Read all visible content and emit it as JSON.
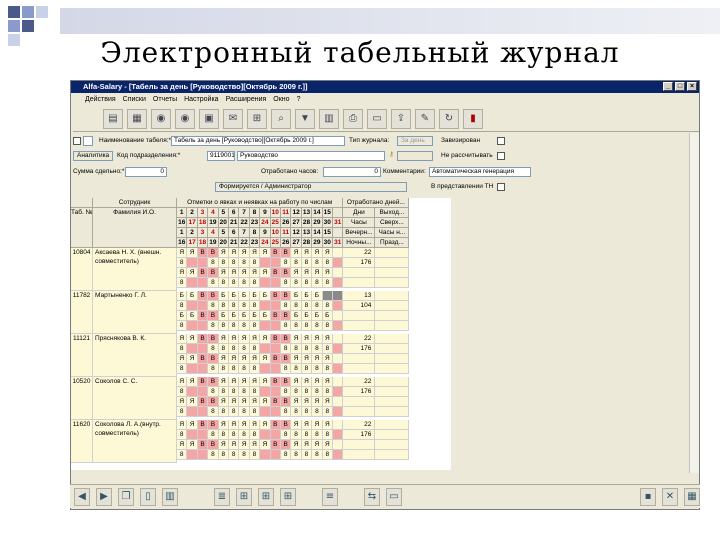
{
  "slide_title": "Электронный табельный журнал",
  "window": {
    "title": "Alfa-Salary - [Табель за день [Руководство][Октябрь 2009 г.]]",
    "controls": [
      "_",
      "□",
      "×"
    ]
  },
  "menu": [
    "Действия",
    "Списки",
    "Отчеты",
    "Настройка",
    "Расширения",
    "Окно",
    "?"
  ],
  "form": {
    "name_label": "Наименование табеля:*",
    "name_value": "Табель за день [Руководство][Октябрь 2009 г.]",
    "journal_type_label": "Тип журнала:",
    "journal_type_value": "За день",
    "completed_label": "Завизирован",
    "analytics_button": "Аналитика",
    "dept_code_label": "Код подразделения:*",
    "dept_code_value": "9119001",
    "dept_name_value": "Руководство",
    "no_calc_label": "Не рассчитывать",
    "sum_label": "Сумма сдельно:*",
    "sum_value": "0",
    "worked_hours_label": "Отработано часов:",
    "worked_hours_value": "0",
    "comment_label": "Комментарии:",
    "comment_value": "Автоматическая генерация",
    "formed_value": "Формируется / Администратор",
    "in_tn_label": "В представлении ТН"
  },
  "grid": {
    "col_tab": "Таб. №",
    "col_emp_header": "Сотрудник",
    "col_fio": "Фамилия И.О.",
    "marks_header": "Отметки о явках и неявках на работу по числам",
    "worked_header": "Отработано дней...",
    "day_row1": [
      "1",
      "2",
      "3",
      "4",
      "5",
      "6",
      "7",
      "8",
      "9",
      "10",
      "11",
      "12",
      "13",
      "14",
      "15"
    ],
    "day_row2": [
      "16",
      "17",
      "18",
      "19",
      "20",
      "21",
      "22",
      "23",
      "24",
      "25",
      "26",
      "27",
      "28",
      "29",
      "30",
      "31"
    ],
    "worked_sub": [
      [
        "Дни",
        "Выход..."
      ],
      [
        "Часы",
        "Сверх..."
      ],
      [
        "Вечерн...",
        "Часы н..."
      ],
      [
        "Ночны...",
        "Празд..."
      ]
    ],
    "red_days": [
      "3",
      "4",
      "10",
      "11",
      "17",
      "18",
      "24",
      "25",
      "31"
    ],
    "employees": [
      {
        "tab": "10804",
        "name": "Аксаева Н. Х. (внешн. совместитель)",
        "days": "22",
        "hours": "176",
        "mark": "Я",
        "num": "8"
      },
      {
        "tab": "11782",
        "name": "Мартыненко Г. Л.",
        "days": "13",
        "hours": "104",
        "mark": "Б",
        "num": "8"
      },
      {
        "tab": "11121",
        "name": "Пряснякова В. К.",
        "days": "22",
        "hours": "176",
        "mark": "Я",
        "num": "8"
      },
      {
        "tab": "10520",
        "name": "Соколов С. С.",
        "days": "22",
        "hours": "176",
        "mark": "Я",
        "num": "8"
      },
      {
        "tab": "11620",
        "name": "Соколова Л. А.(внутр. совместитель)",
        "days": "22",
        "hours": "176",
        "mark": "Я",
        "num": "8"
      }
    ],
    "weekend_mark": "В"
  },
  "colors": {
    "title_bar": "#0a246a",
    "weekend": "#f4a6a6",
    "row_bg": "#fdf9d7",
    "window_bg": "#ece9d8"
  }
}
